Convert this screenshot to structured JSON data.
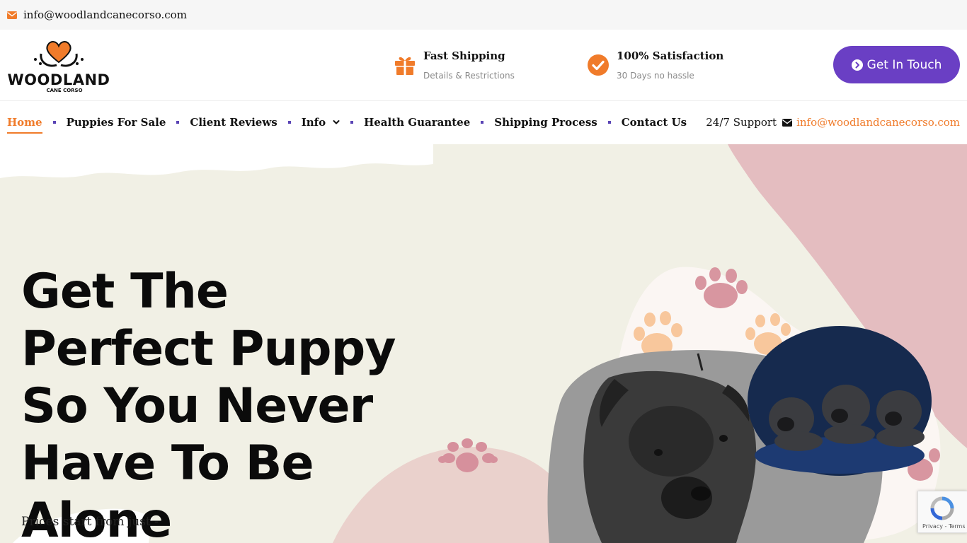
{
  "topbar": {
    "email": "info@woodlandcanecorso.com",
    "mail_icon": "envelope-icon"
  },
  "logo": {
    "word": "WOODLAND",
    "sub": "CANE CORSO"
  },
  "features": [
    {
      "title": "Fast Shipping",
      "subtitle": "Details & Restrictions",
      "icon": "gift-icon"
    },
    {
      "title": "100% Satisfaction",
      "subtitle": "30 Days no hassle",
      "icon": "check-circle-icon"
    }
  ],
  "cta": {
    "label": "Get In Touch",
    "icon": "chevron-circle-right-icon"
  },
  "nav": {
    "items": [
      {
        "label": "Home",
        "active": true
      },
      {
        "label": "Puppies For Sale"
      },
      {
        "label": "Client Reviews"
      },
      {
        "label": "Info",
        "has_dropdown": true
      },
      {
        "label": "Health Guarantee"
      },
      {
        "label": "Shipping Process"
      },
      {
        "label": "Contact Us"
      }
    ],
    "support_label": "24/7 Support",
    "support_email": "info@woodlandcanecorso.com"
  },
  "hero": {
    "headline": "Get The Perfect Puppy So You Never Have To Be Alone",
    "prices": "Prices start from just -"
  },
  "recaptcha": {
    "text": "Privacy - Terms"
  },
  "colors": {
    "accent": "#f07b2a",
    "purple": "#6a3fc4",
    "hero_bg": "#f1f0e5",
    "pink": "#e3b9bd"
  }
}
